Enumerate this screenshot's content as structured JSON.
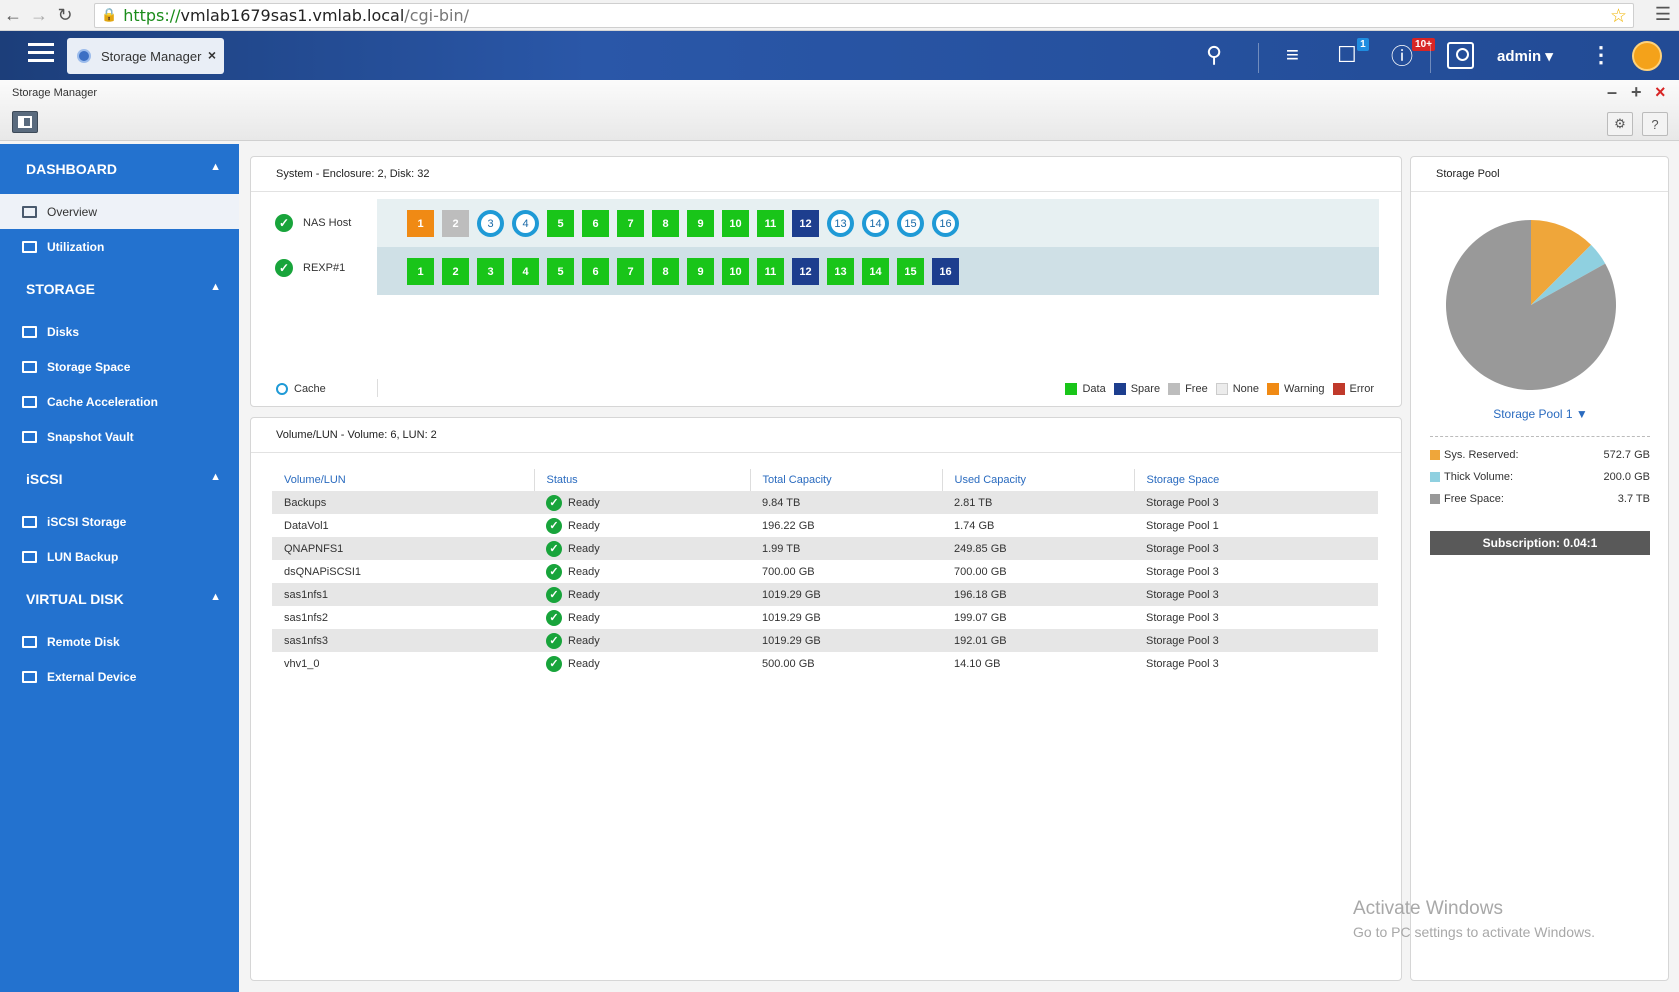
{
  "browser": {
    "url_protocol": "https://",
    "url_host": "vmlab1679sas1.vmlab.local",
    "url_path": "/cgi-bin/"
  },
  "topbar": {
    "tab_label": "Storage Manager",
    "notification_badge": "1",
    "info_badge": "10+",
    "user_name": "admin"
  },
  "window": {
    "title": "Storage Manager"
  },
  "sidebar": {
    "sections": [
      {
        "label": "DASHBOARD",
        "items": [
          "Overview",
          "Utilization"
        ]
      },
      {
        "label": "STORAGE",
        "items": [
          "Disks",
          "Storage Space",
          "Cache Acceleration",
          "Snapshot Vault"
        ]
      },
      {
        "label": "iSCSI",
        "items": [
          "iSCSI Storage",
          "LUN Backup"
        ]
      },
      {
        "label": "VIRTUAL DISK",
        "items": [
          "Remote Disk",
          "External Device"
        ]
      }
    ],
    "active_item": "Overview"
  },
  "enclosure": {
    "title": "System - Enclosure: 2, Disk: 32",
    "rows": [
      {
        "label": "NAS Host",
        "disks": [
          {
            "n": "1",
            "state": "warning"
          },
          {
            "n": "2",
            "state": "free"
          },
          {
            "n": "3",
            "state": "cache"
          },
          {
            "n": "4",
            "state": "cache"
          },
          {
            "n": "5",
            "state": "data"
          },
          {
            "n": "6",
            "state": "data"
          },
          {
            "n": "7",
            "state": "data"
          },
          {
            "n": "8",
            "state": "data"
          },
          {
            "n": "9",
            "state": "data"
          },
          {
            "n": "10",
            "state": "data"
          },
          {
            "n": "11",
            "state": "data"
          },
          {
            "n": "12",
            "state": "spare"
          },
          {
            "n": "13",
            "state": "cache"
          },
          {
            "n": "14",
            "state": "cache"
          },
          {
            "n": "15",
            "state": "cache"
          },
          {
            "n": "16",
            "state": "cache"
          }
        ]
      },
      {
        "label": "REXP#1",
        "disks": [
          {
            "n": "1",
            "state": "data"
          },
          {
            "n": "2",
            "state": "data"
          },
          {
            "n": "3",
            "state": "data"
          },
          {
            "n": "4",
            "state": "data"
          },
          {
            "n": "5",
            "state": "data"
          },
          {
            "n": "6",
            "state": "data"
          },
          {
            "n": "7",
            "state": "data"
          },
          {
            "n": "8",
            "state": "data"
          },
          {
            "n": "9",
            "state": "data"
          },
          {
            "n": "10",
            "state": "data"
          },
          {
            "n": "11",
            "state": "data"
          },
          {
            "n": "12",
            "state": "spare"
          },
          {
            "n": "13",
            "state": "data"
          },
          {
            "n": "14",
            "state": "data"
          },
          {
            "n": "15",
            "state": "data"
          },
          {
            "n": "16",
            "state": "spare"
          }
        ]
      }
    ],
    "cache_label": "Cache",
    "legend": [
      {
        "label": "Data",
        "color": "#19c519"
      },
      {
        "label": "Spare",
        "color": "#1d3e8e"
      },
      {
        "label": "Free",
        "color": "#bdbdbd"
      },
      {
        "label": "None",
        "color": "#ececec"
      },
      {
        "label": "Warning",
        "color": "#f08a14"
      },
      {
        "label": "Error",
        "color": "#c0392b"
      }
    ]
  },
  "volumes": {
    "title": "Volume/LUN - Volume: 6, LUN: 2",
    "headers": [
      "Volume/LUN",
      "Status",
      "Total Capacity",
      "Used Capacity",
      "Storage Space"
    ],
    "rows": [
      [
        "Backups",
        "Ready",
        "9.84 TB",
        "2.81 TB",
        "Storage Pool 3"
      ],
      [
        "DataVol1",
        "Ready",
        "196.22 GB",
        "1.74 GB",
        "Storage Pool 1"
      ],
      [
        "QNAPNFS1",
        "Ready",
        "1.99 TB",
        "249.85 GB",
        "Storage Pool 3"
      ],
      [
        "dsQNAPiSCSI1",
        "Ready",
        "700.00 GB",
        "700.00 GB",
        "Storage Pool 3"
      ],
      [
        "sas1nfs1",
        "Ready",
        "1019.29 GB",
        "196.18 GB",
        "Storage Pool 3"
      ],
      [
        "sas1nfs2",
        "Ready",
        "1019.29 GB",
        "199.07 GB",
        "Storage Pool 3"
      ],
      [
        "sas1nfs3",
        "Ready",
        "1019.29 GB",
        "192.01 GB",
        "Storage Pool 3"
      ],
      [
        "vhv1_0",
        "Ready",
        "500.00 GB",
        "14.10 GB",
        "Storage Pool 3"
      ]
    ]
  },
  "pool": {
    "title": "Storage Pool",
    "selected": "Storage Pool 1",
    "breakdown": [
      {
        "label": "Sys. Reserved:",
        "value": "572.7 GB",
        "color": "#efa63a"
      },
      {
        "label": "Thick Volume:",
        "value": "200.0 GB",
        "color": "#8fd0e0"
      },
      {
        "label": "Free Space:",
        "value": "3.7 TB",
        "color": "#999999"
      }
    ],
    "pie_fractions": [
      0.125,
      0.044,
      0.831
    ],
    "subscription": "Subscription: 0.04:1"
  },
  "watermark": {
    "line1": "Activate Windows",
    "line2": "Go to PC settings to activate Windows."
  }
}
